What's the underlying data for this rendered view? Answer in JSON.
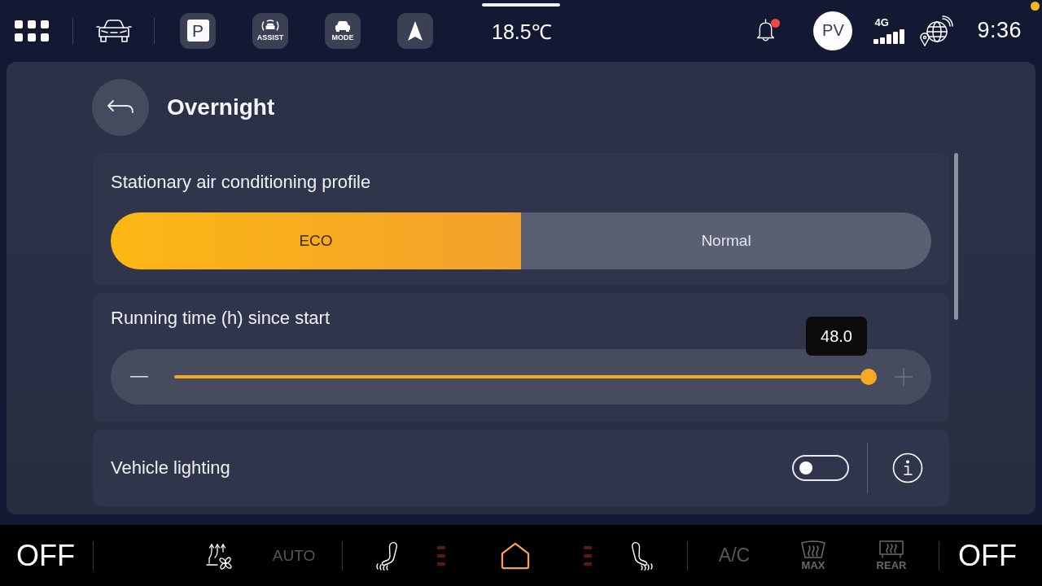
{
  "status_bar": {
    "quick_buttons": [
      {
        "kind": "parking",
        "label": "P"
      },
      {
        "kind": "assist",
        "label": "ASSIST"
      },
      {
        "kind": "mode",
        "label": "MODE"
      },
      {
        "kind": "navigation"
      }
    ],
    "temperature": "18.5℃",
    "notifications": {
      "unread": true
    },
    "profile": {
      "initials": "PV"
    },
    "network": {
      "label": "4G"
    },
    "time": "9:36"
  },
  "page": {
    "title": "Overnight"
  },
  "settings": [
    {
      "kind": "segmented",
      "title": "Stationary air conditioning profile",
      "options": [
        {
          "label": "ECO",
          "selected": true
        },
        {
          "label": "Normal",
          "selected": false
        }
      ]
    },
    {
      "kind": "slider",
      "title": "Running time (h) since start",
      "value": "48.0",
      "level": 1
    },
    {
      "kind": "toggle",
      "title": "Vehicle lighting",
      "on": false
    }
  ],
  "climate_bar": {
    "left_label": "OFF",
    "auto": {
      "label": "AUTO",
      "active": false
    },
    "left_seat_heat": {
      "steps": [
        {
          "on": false
        },
        {
          "on": false
        },
        {
          "on": false
        }
      ]
    },
    "right_seat_heat": {
      "steps": [
        {
          "on": false
        },
        {
          "on": false
        },
        {
          "on": false
        }
      ]
    },
    "ac": {
      "label": "A/C",
      "active": false
    },
    "defrost": [
      {
        "kind": "max",
        "label": "MAX",
        "active": false
      },
      {
        "kind": "rear",
        "label": "REAR",
        "active": false
      }
    ],
    "right_label": "OFF"
  }
}
